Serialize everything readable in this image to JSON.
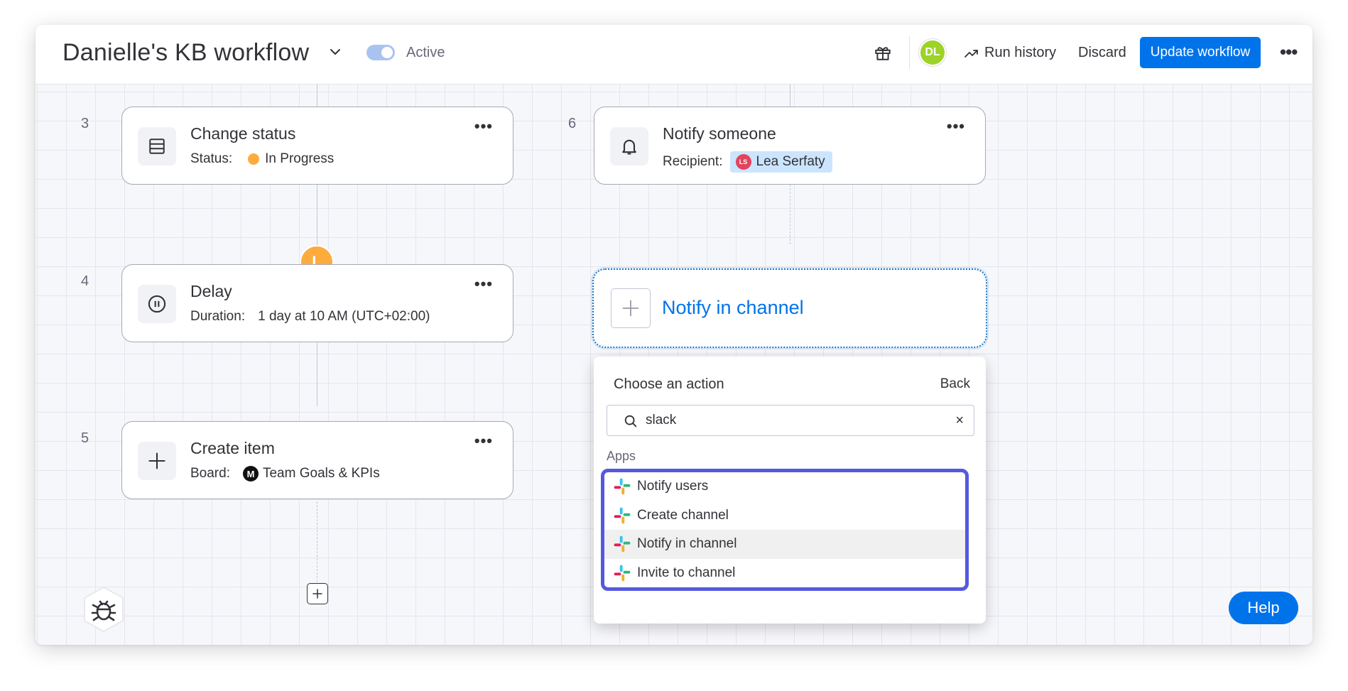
{
  "header": {
    "title": "Danielle's KB workflow",
    "toggle_label": "Active",
    "toggle_on": true,
    "avatar_initials": "DL",
    "run_history": "Run history",
    "discard": "Discard",
    "update_workflow": "Update workflow",
    "more": "•••"
  },
  "steps": [
    {
      "number": "3",
      "title": "Change status",
      "field_label": "Status:",
      "field_value": "In Progress",
      "icon": "list-icon",
      "more": "•••"
    },
    {
      "number": "4",
      "title": "Delay",
      "field_label": "Duration:",
      "field_value": "1 day at 10 AM (UTC+02:00)",
      "icon": "pause-circle-icon",
      "more": "•••"
    },
    {
      "number": "5",
      "title": "Create item",
      "field_label": "Board:",
      "board_badge": "M",
      "field_value": "Team Goals & KPIs",
      "icon": "plus-icon",
      "more": "•••"
    },
    {
      "number": "6",
      "title": "Notify someone",
      "field_label": "Recipient:",
      "recipient_initials": "LS",
      "field_value": "Lea Serfaty",
      "icon": "bell-icon",
      "more": "•••"
    }
  ],
  "delay_marker": "L",
  "placeholder": {
    "label": "Notify in channel"
  },
  "dropdown": {
    "title": "Choose an action",
    "back": "Back",
    "search_value": "slack",
    "clear": "×",
    "section": "Apps",
    "items": [
      {
        "label": "Notify users",
        "icon": "slack-icon",
        "highlighted": false
      },
      {
        "label": "Create channel",
        "icon": "slack-icon",
        "highlighted": false
      },
      {
        "label": "Notify in channel",
        "icon": "slack-icon",
        "highlighted": true
      },
      {
        "label": "Invite to channel",
        "icon": "slack-icon",
        "highlighted": false
      }
    ]
  },
  "help": "Help",
  "colors": {
    "primary": "#0073ea",
    "status_in_progress": "#fdab3d",
    "avatar": "#9cd326",
    "highlight_border": "#5559df"
  }
}
